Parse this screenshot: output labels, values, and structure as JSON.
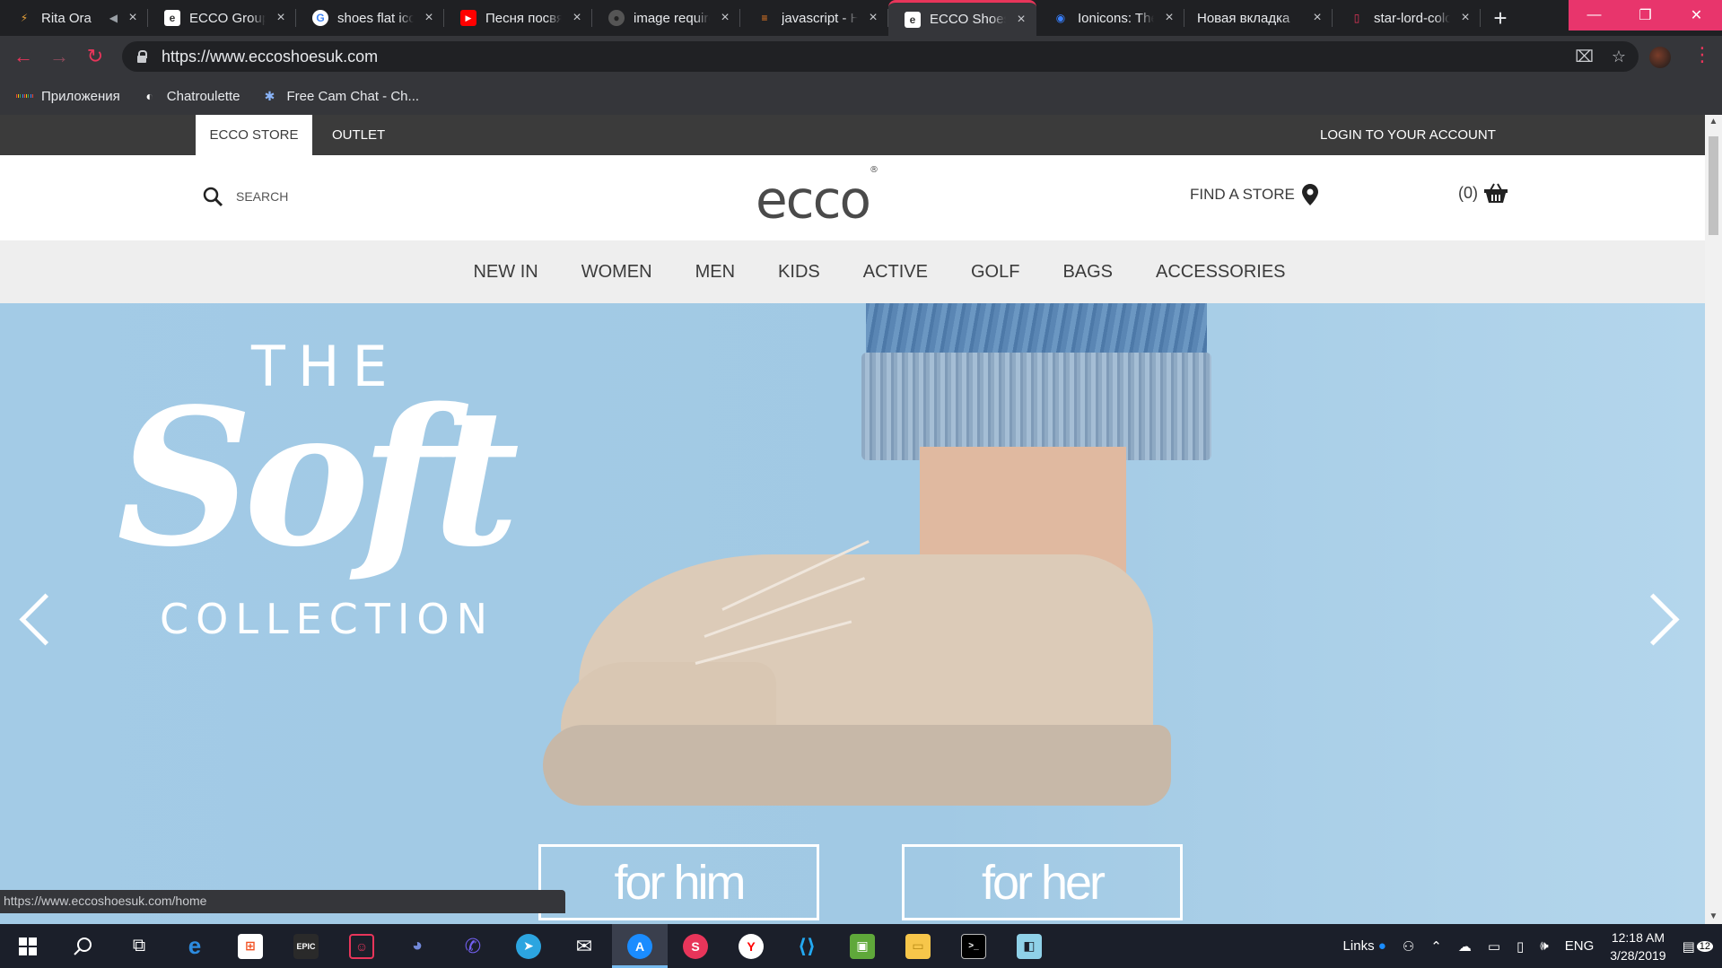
{
  "browser": {
    "tabs": [
      {
        "title": "Rita Ora",
        "favicon_color": "#e8a23a",
        "favicon_glyph": "⚡"
      },
      {
        "title": "ECCO Group",
        "favicon_color": "#ffffff",
        "favicon_glyph": "e"
      },
      {
        "title": "shoes flat icon",
        "favicon_color": "#ffffff",
        "favicon_glyph": "G"
      },
      {
        "title": "Песня посвящ",
        "favicon_color": "#ff0000",
        "favicon_glyph": "▶"
      },
      {
        "title": "image require",
        "favicon_color": "#3a3a3a",
        "favicon_glyph": "●"
      },
      {
        "title": "javascript - H",
        "favicon_color": "#f48024",
        "favicon_glyph": "≡"
      },
      {
        "title": "ECCO Shoes",
        "favicon_color": "#ffffff",
        "favicon_glyph": "e",
        "active": true
      },
      {
        "title": "Ionicons: The",
        "favicon_color": "#3880ff",
        "favicon_glyph": "◉"
      },
      {
        "title": "Новая вкладка",
        "favicon_color": "",
        "favicon_glyph": ""
      },
      {
        "title": "star-lord-color",
        "favicon_color": "#e8355a",
        "favicon_glyph": "▯"
      }
    ],
    "url": "https://www.eccoshoesuk.com",
    "bookmarks": [
      {
        "label": "Приложения"
      },
      {
        "label": "Chatroulette"
      },
      {
        "label": "Free Cam Chat - Ch..."
      }
    ],
    "status_url": "https://www.eccoshoesuk.com/home",
    "accent_color": "#e8355a"
  },
  "site": {
    "topnav": {
      "store": "ECCO STORE",
      "outlet": "OUTLET",
      "login": "LOGIN TO YOUR ACCOUNT"
    },
    "search_placeholder": "SEARCH",
    "logo": "ecco",
    "find_store": "FIND A STORE",
    "cart_count": "(0)",
    "categories": [
      "NEW IN",
      "WOMEN",
      "MEN",
      "KIDS",
      "ACTIVE",
      "GOLF",
      "BAGS",
      "ACCESSORIES"
    ],
    "hero": {
      "line1": "THE",
      "line2": "Soft",
      "line3": "COLLECTION",
      "cta_him": "for him",
      "cta_her": "for her"
    }
  },
  "taskbar": {
    "apps": [
      "windows-start",
      "search",
      "task-view",
      "edge",
      "store",
      "epic-games",
      "davinci",
      "discord",
      "viber",
      "telegram",
      "mail",
      "app-store",
      "skype",
      "yandex",
      "vscode",
      "minecraft",
      "file-explorer",
      "terminal",
      "notes"
    ],
    "links_label": "Links",
    "lang": "ENG",
    "time": "12:18 AM",
    "date": "3/28/2019",
    "notifications": "12"
  }
}
